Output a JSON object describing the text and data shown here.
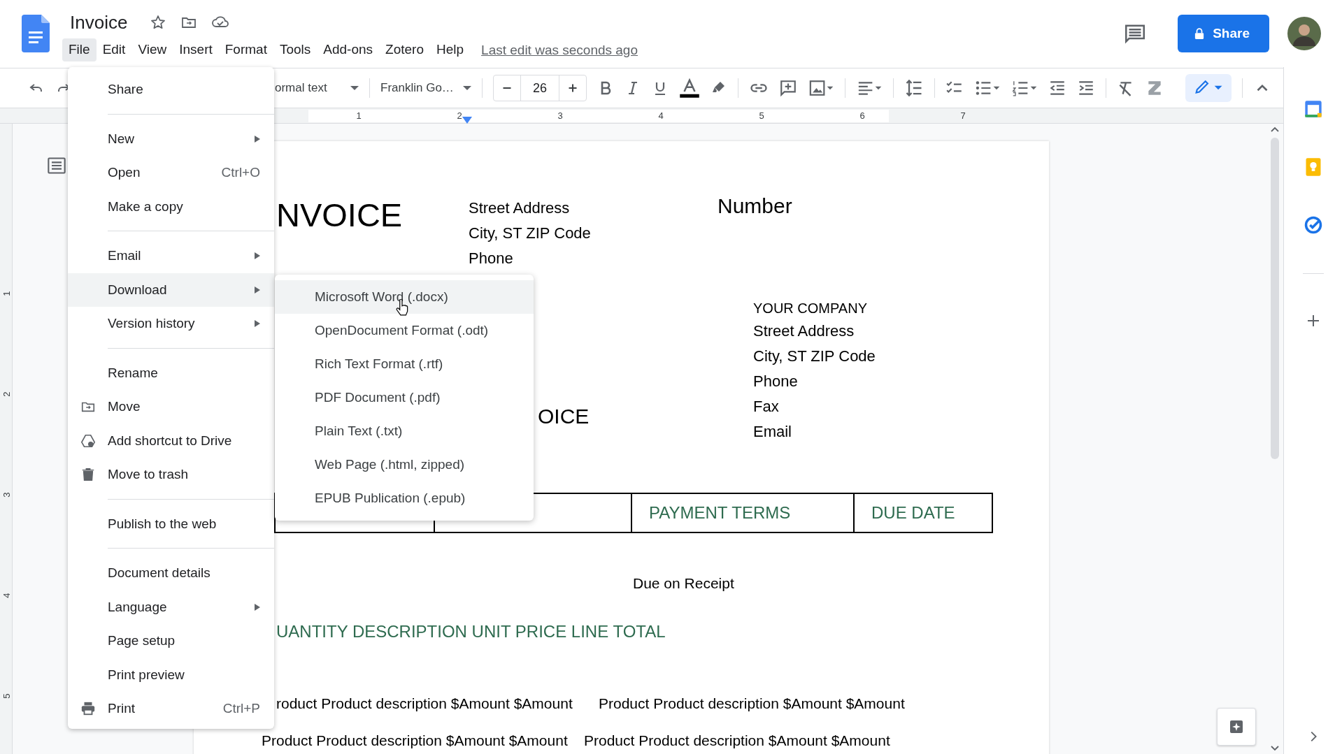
{
  "app": {
    "title": "Invoice",
    "last_edit": "Last edit was seconds ago",
    "share_label": "Share"
  },
  "menubar": [
    {
      "label": "File",
      "selected": true
    },
    {
      "label": "Edit",
      "selected": false
    },
    {
      "label": "View",
      "selected": false
    },
    {
      "label": "Insert",
      "selected": false
    },
    {
      "label": "Format",
      "selected": false
    },
    {
      "label": "Tools",
      "selected": false
    },
    {
      "label": "Add-ons",
      "selected": false
    },
    {
      "label": "Zotero",
      "selected": false
    },
    {
      "label": "Help",
      "selected": false
    }
  ],
  "toolbar": {
    "style": "ormal text",
    "font": "Franklin Go…",
    "font_size": "26"
  },
  "ruler": [
    "1",
    "2",
    "3",
    "4",
    "5",
    "6",
    "7"
  ],
  "vertical_ruler": [
    "1",
    "2",
    "3",
    "4",
    "5"
  ],
  "file_menu": [
    {
      "kind": "item",
      "label": "Share",
      "submenu": false,
      "selected": false
    },
    {
      "kind": "divider"
    },
    {
      "kind": "item",
      "label": "New",
      "submenu": true,
      "selected": false
    },
    {
      "kind": "item",
      "label": "Open",
      "shortcut": "Ctrl+O",
      "submenu": false,
      "selected": false
    },
    {
      "kind": "item",
      "label": "Make a copy",
      "submenu": false,
      "selected": false
    },
    {
      "kind": "divider"
    },
    {
      "kind": "item",
      "label": "Email",
      "submenu": true,
      "selected": false
    },
    {
      "kind": "item",
      "label": "Download",
      "submenu": true,
      "selected": true
    },
    {
      "kind": "item",
      "label": "Version history",
      "submenu": true,
      "selected": false
    },
    {
      "kind": "divider"
    },
    {
      "kind": "item",
      "label": "Rename",
      "submenu": false,
      "selected": false
    },
    {
      "kind": "move",
      "label": "Move",
      "submenu": false,
      "selected": false
    },
    {
      "kind": "shortcut",
      "label": "Add shortcut to Drive",
      "submenu": false,
      "selected": false
    },
    {
      "kind": "trash",
      "label": "Move to trash",
      "submenu": false,
      "selected": false
    },
    {
      "kind": "divider"
    },
    {
      "kind": "item",
      "label": "Publish to the web",
      "submenu": false,
      "selected": false
    },
    {
      "kind": "divider"
    },
    {
      "kind": "item",
      "label": "Document details",
      "submenu": false,
      "selected": false
    },
    {
      "kind": "item",
      "label": "Language",
      "submenu": true,
      "selected": false
    },
    {
      "kind": "item",
      "label": "Page setup",
      "submenu": false,
      "selected": false
    },
    {
      "kind": "item",
      "label": "Print preview",
      "submenu": false,
      "selected": false
    },
    {
      "kind": "print",
      "label": "Print",
      "shortcut": "Ctrl+P",
      "submenu": false,
      "selected": false
    }
  ],
  "download_menu": [
    {
      "label": "Microsoft Word (.docx)",
      "selected": true
    },
    {
      "label": "OpenDocument Format (.odt)",
      "selected": false
    },
    {
      "label": "Rich Text Format (.rtf)",
      "selected": false
    },
    {
      "label": "PDF Document (.pdf)",
      "selected": false
    },
    {
      "label": "Plain Text (.txt)",
      "selected": false
    },
    {
      "label": "Web Page (.html, zipped)",
      "selected": false
    },
    {
      "label": "EPUB Publication (.epub)",
      "selected": false
    }
  ],
  "document": {
    "title_fragment": "NVOICE",
    "sender": [
      "Street Address",
      "City, ST ZIP Code",
      "Phone"
    ],
    "number_label": "Number",
    "title_fragment_2": "OICE",
    "company": [
      "YOUR COMPANY",
      "Street Address",
      "City, ST ZIP Code",
      "Phone",
      "Fax",
      "Email"
    ],
    "terms_headers": [
      "PAYMENT TERMS",
      "DUE DATE"
    ],
    "terms_value": "Due on Receipt",
    "items_heading": "UANTITY DESCRIPTION UNIT PRICE LINE TOTAL",
    "item_rows": [
      [
        "roduct Product description $Amount $Amount",
        "Product Product description $Amount $Amount"
      ],
      [
        "Product Product description $Amount $Amount",
        "Product Product description $Amount $Amount"
      ]
    ]
  }
}
